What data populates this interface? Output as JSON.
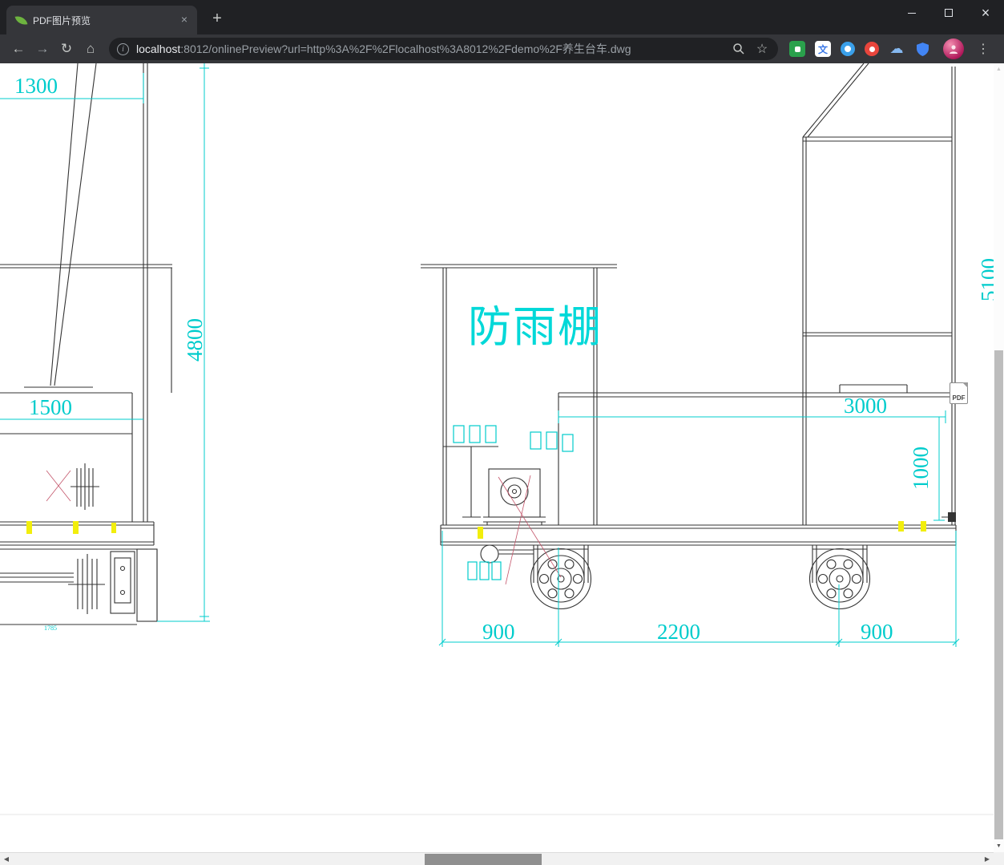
{
  "tab": {
    "title": "PDF图片预览",
    "close_glyph": "×"
  },
  "window_controls": {
    "close_glyph": "×"
  },
  "glyphs": {
    "back": "←",
    "forward": "→",
    "reload": "↻",
    "home": "⌂",
    "new_tab": "+",
    "bookmark": "☆",
    "menu": "⋮",
    "info": "i",
    "translate": "文",
    "cloud": "☁",
    "scroll_up": "▲",
    "scroll_down": "▼",
    "scroll_left": "◀",
    "scroll_right": "▶"
  },
  "url": {
    "host": "localhost",
    "path": ":8012/onlinePreview?url=http%3A%2F%2Flocalhost%3A8012%2Fdemo%2F养生台车.dwg"
  },
  "drawing": {
    "shelter_label": "防雨棚",
    "pdf_badge": "PDF",
    "dims": {
      "top_width": "1300",
      "left_height": "4800",
      "cab_width": "1500",
      "right_height": "5100",
      "bed_length": "3000",
      "bed_height": "1000",
      "front_overhang": "900",
      "wheelbase": "2200",
      "rear_overhang": "900",
      "small_dim": "1785"
    },
    "colors": {
      "dimension": "#00cccc",
      "linework": "#333333",
      "highlight": "#f2ee0c",
      "centerline": "#c4566b"
    }
  }
}
